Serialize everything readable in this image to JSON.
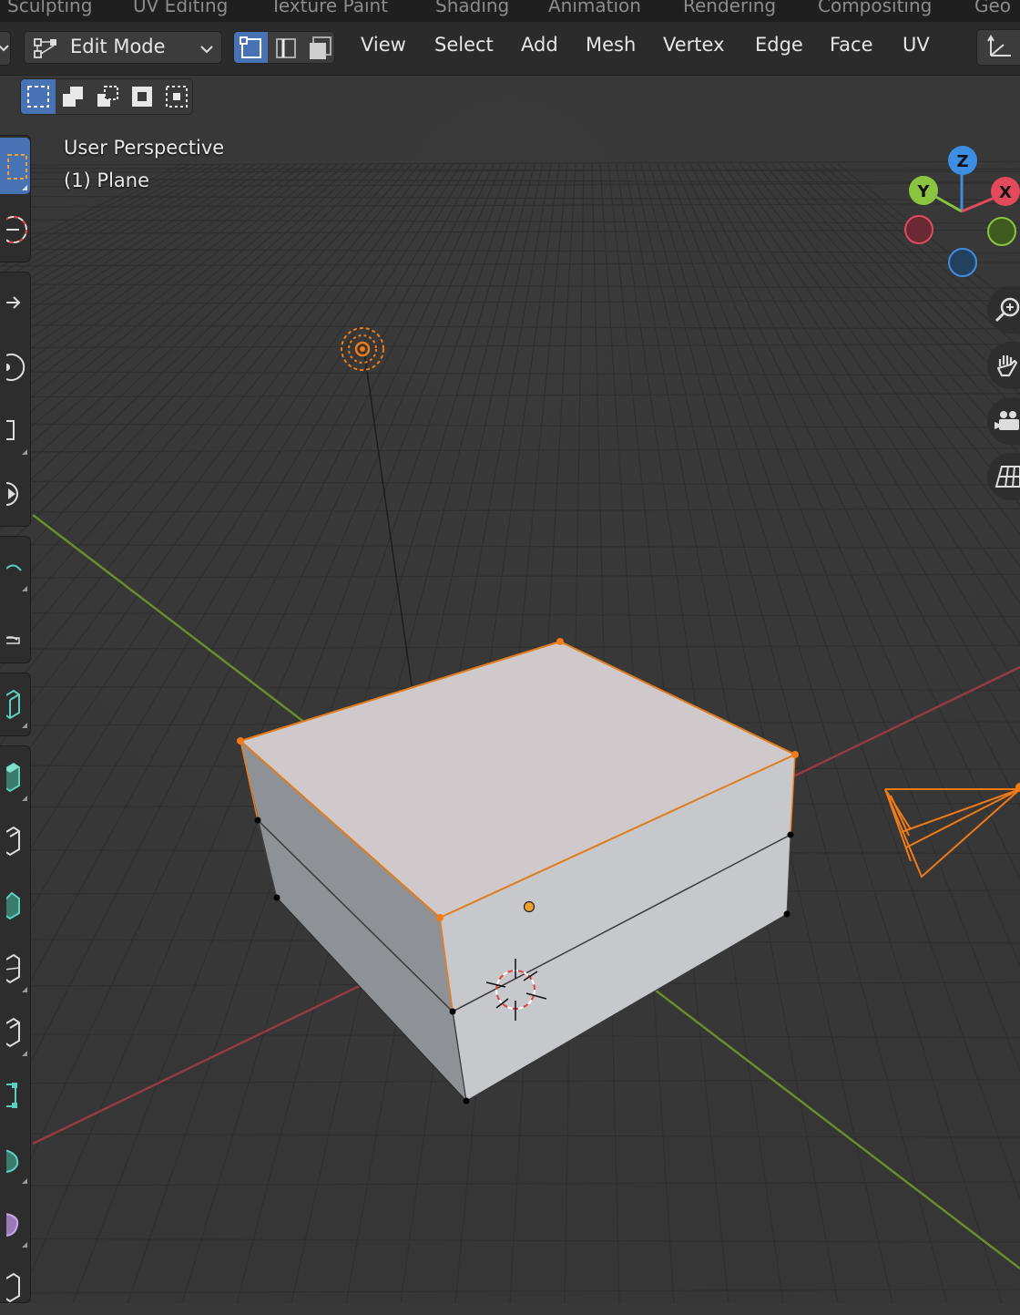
{
  "workspace_tabs": [
    "Sculpting",
    "UV Editing",
    "Texture Paint",
    "Shading",
    "Animation",
    "Rendering",
    "Compositing",
    "Geo"
  ],
  "header": {
    "mode_label": "Edit Mode",
    "menus": [
      "View",
      "Select",
      "Add",
      "Mesh",
      "Vertex",
      "Edge",
      "Face",
      "UV"
    ],
    "select_mode_active": "vertex"
  },
  "viewport": {
    "view_name": "User Perspective",
    "object_label": "(1) Plane"
  },
  "gizmo": {
    "z_label": "Z",
    "y_label": "Y",
    "x_label": "X",
    "colors": {
      "x": "#e34a5c",
      "y": "#8bc440",
      "z": "#3d8de3"
    }
  },
  "icons": {
    "nav": [
      "zoom-icon",
      "pan-hand-icon",
      "camera-view-icon",
      "perspective-grid-icon"
    ]
  },
  "colors": {
    "viewport_bg": "#393939",
    "selection_orange": "#f07b17",
    "active_blue": "#4772b3"
  }
}
